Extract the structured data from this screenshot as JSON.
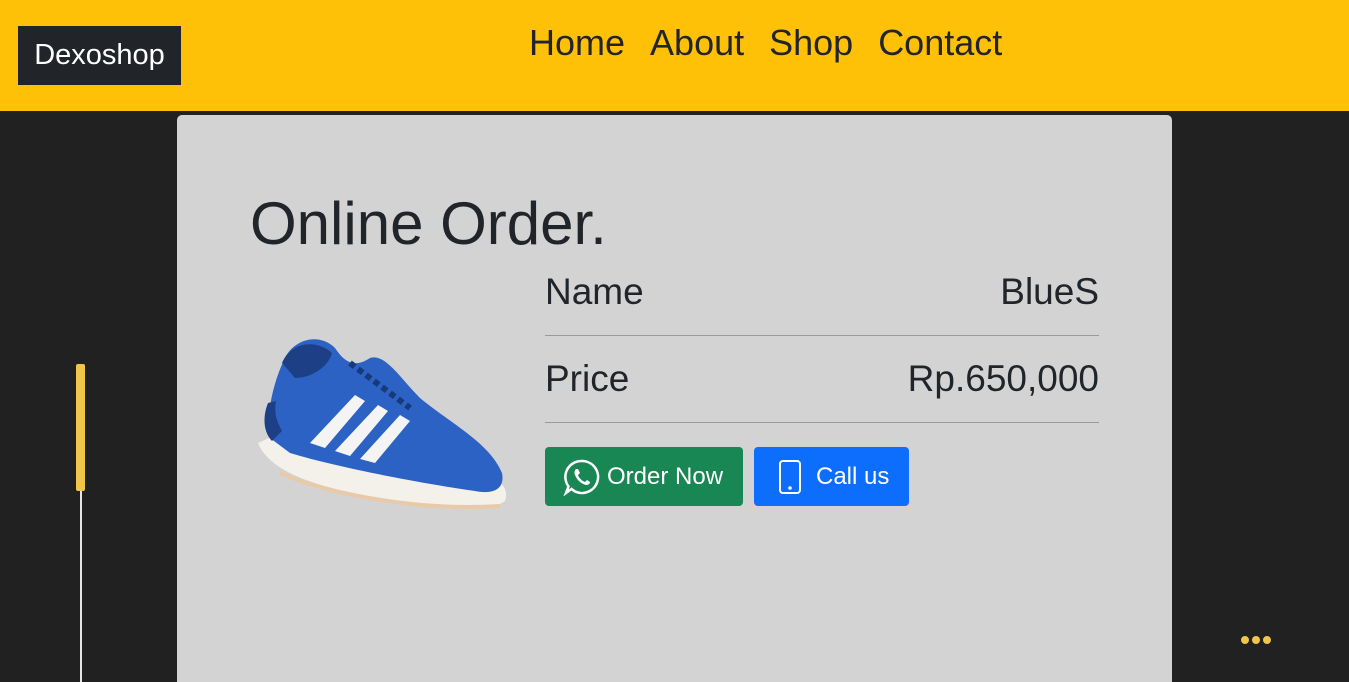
{
  "navbar": {
    "brand": "Dexoshop",
    "links": [
      {
        "label": "Home"
      },
      {
        "label": "About"
      },
      {
        "label": "Shop"
      },
      {
        "label": "Contact"
      }
    ],
    "background": "#ffc107"
  },
  "order": {
    "title": "Online Order.",
    "product_image": "blue-sneaker-image",
    "fields": [
      {
        "label": "Name",
        "value": "BlueS"
      },
      {
        "label": "Price",
        "value": "Rp.650,000"
      }
    ],
    "buttons": {
      "order_label": "Order Now",
      "order_icon": "whatsapp-icon",
      "order_color": "#198754",
      "call_label": "Call us",
      "call_icon": "phone-icon",
      "call_color": "#0d6efd"
    }
  },
  "colors": {
    "page_bg": "#212121",
    "card_bg": "#d3d3d3",
    "accent": "#f0c64a"
  }
}
